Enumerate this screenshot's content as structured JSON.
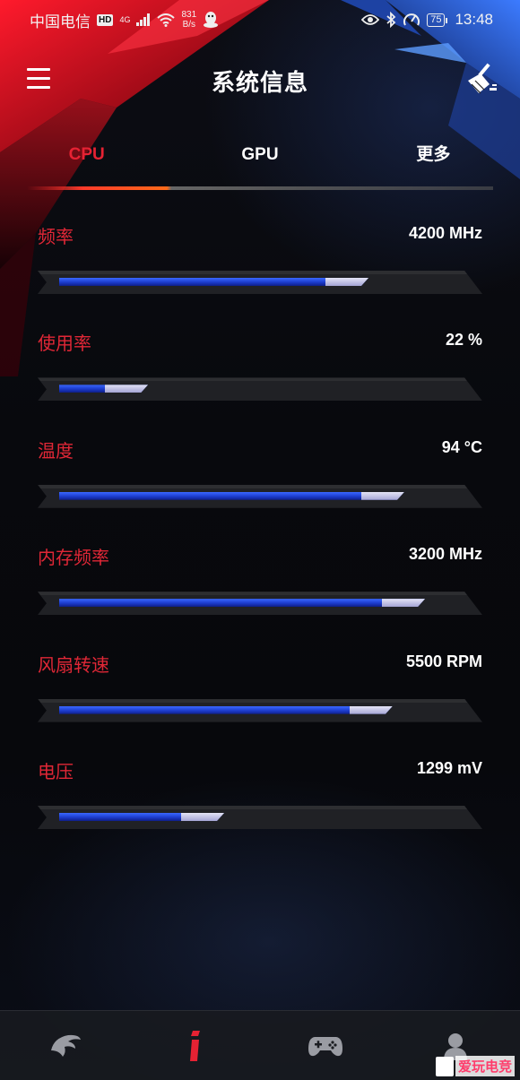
{
  "status_bar": {
    "carrier": "中国电信",
    "hd": "HD",
    "network": "4G",
    "speed_value": "831",
    "speed_unit": "B/s",
    "battery": "75",
    "time": "13:48"
  },
  "header": {
    "title": "系统信息",
    "menu_icon": "hamburger-menu-icon",
    "clean_icon": "broom-clean-icon"
  },
  "tabs": [
    {
      "label": "CPU",
      "active": true
    },
    {
      "label": "GPU",
      "active": false
    },
    {
      "label": "更多",
      "active": false
    }
  ],
  "metrics": [
    {
      "label": "频率",
      "value": "4200 MHz",
      "fill": 0.77
    },
    {
      "label": "使用率",
      "value": "22 %",
      "fill": 0.22
    },
    {
      "label": "温度",
      "value": "94 °C",
      "fill": 0.86
    },
    {
      "label": "内存频率",
      "value": "3200 MHz",
      "fill": 0.91
    },
    {
      "label": "风扇转速",
      "value": "5500 RPM",
      "fill": 0.83
    },
    {
      "label": "电压",
      "value": "1299 mV",
      "fill": 0.41
    }
  ],
  "bottom_nav": [
    {
      "icon": "rog-eye-icon",
      "active": false
    },
    {
      "icon": "info-icon",
      "active": true
    },
    {
      "icon": "gamepad-icon",
      "active": false
    },
    {
      "icon": "profile-icon",
      "active": false
    }
  ],
  "watermark": "爱玩电竞",
  "colors": {
    "accent_red": "#e62233",
    "bar_blue": "#2a4ee6",
    "bar_tip": "#c8c8ea",
    "background": "#07080c"
  }
}
